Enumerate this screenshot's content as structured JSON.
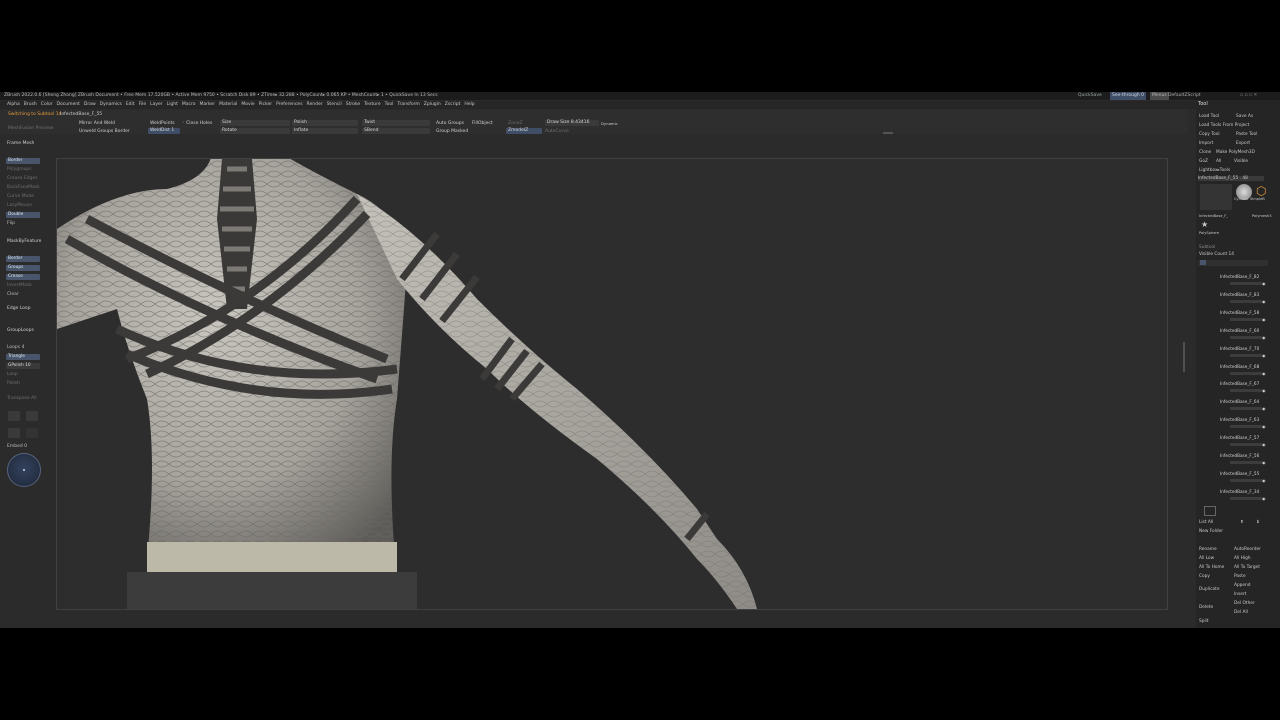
{
  "window": {
    "title": "ZBrush 2022.0.6 [Sheng Zhong]  ZBrush Document   • Free Mem 17.520GB • Active Mem 9750 • Scratch Disk 89 • ZTime▸ 32.288 • PolyCount▸ 0.065 KP • MeshCount▸ 1   • QuickSave In 13 Secs",
    "quicksave": "QuickSave",
    "see_through": "See-through  0",
    "menus_label": "Menus",
    "default_script": "DefaultZScript"
  },
  "menubar": [
    "Alpha",
    "Brush",
    "Color",
    "Document",
    "Draw",
    "Dynamics",
    "Edit",
    "File",
    "Layer",
    "Light",
    "Macro",
    "Marker",
    "Material",
    "Movie",
    "Picker",
    "Preferences",
    "Render",
    "Stencil",
    "Stroke",
    "Texture",
    "Tool",
    "Transform",
    "Zplugin",
    "Zscript",
    "Help"
  ],
  "toolshelf": {
    "status": "Switching to Subtool 14",
    "subtool_name": "InfectedBase_F_55",
    "mesh_preview": "MeshFusion Preview",
    "mirror_weld": "Mirror And Weld",
    "unweld": "Unweld Groups Border",
    "weld_points": "WeldPoints",
    "weld_dist": "WeldDist 1",
    "close_holes": "Close Holes",
    "size": "Size",
    "rotate": "Rotate",
    "polish": "Polish",
    "inflate": "Inflate",
    "twist": "Twist",
    "sbend": "SBend",
    "auto_groups": "Auto Groups",
    "group_masked": "Group Masked",
    "fill_object": "FillObject",
    "draw_size": "Draw Size 8.43416",
    "dynamic": "Dynamic",
    "zmodeler_btn": "ZoneZ",
    "autocurve": "AutoCurve",
    "gizmo_btn": "ZmodelZ"
  },
  "leftpanel": {
    "frame_mesh": "Frame Mesh",
    "border": "Border",
    "polygroups": "Polygroups",
    "crease_edges": "Crease Edges",
    "backface": "BackFaceMask",
    "curve_mode": "Curve Mode",
    "lazy_mouse": "LazyMouse",
    "double": "Double",
    "flip": "Flip",
    "mask_by_feature": "MaskByFeature",
    "border2": "Border",
    "groups": "Groups",
    "crease": "Crease",
    "invert": "InvertMask",
    "clear": "Clear",
    "edge_loop": "Edge Loop",
    "group_loops": "GroupLoops",
    "loops": "Loops 4",
    "triangle": "Triangle",
    "gpolish": "GPolish 10",
    "loop": "Loop",
    "polish": "Polish",
    "transform": "Transpose All",
    "embed": "Embed 0"
  },
  "rightpanel": {
    "tool_title": "Tool",
    "load_tool": "Load Tool",
    "save_as": "Save As",
    "load_tools_project": "Load Tools From Project",
    "copy_tool": "Copy Tool",
    "paste_tool": "Paste Tool",
    "import": "Import",
    "export": "Export",
    "clone": "Clone",
    "make_polymesh": "Make PolyMesh3D",
    "goz": "GoZ",
    "all": "All",
    "visible": "Visible",
    "lightbox_tools": "Lightbox▸Tools",
    "current_tool": "InfectedBase_F_55 . 48",
    "thumb1_label": "InfectedBase_F_",
    "thumb2_label": "Cylinder SimpleB",
    "thumb3_label": "Polymesh3",
    "polysphere": "PolySphere",
    "subtool_label": "Subtool",
    "visible_count": "Visible Count 14",
    "subtools": [
      "InfectedBase_F_82",
      "InfectedBase_F_83",
      "InfectedBase_F_58",
      "InfectedBase_F_60",
      "InfectedBase_F_70",
      "InfectedBase_F_68",
      "InfectedBase_F_67",
      "InfectedBase_F_64",
      "InfectedBase_F_63",
      "InfectedBase_F_57",
      "InfectedBase_F_56",
      "InfectedBase_F_55",
      "InfectedBase_F_34"
    ],
    "list_all": "List All",
    "new_folder": "New Folder",
    "rename": "Rename",
    "auto_reorder": "AutoReorder",
    "all_low": "All Low",
    "all_high": "All High",
    "all_to_home": "All To Home",
    "all_to_target": "All To Target",
    "copy": "Copy",
    "paste": "Paste",
    "duplicate": "Duplicate",
    "append": "Append",
    "insert": "Insert",
    "delete": "Delete",
    "del_other": "Del Other",
    "del_all": "Del All",
    "split": "Split"
  }
}
